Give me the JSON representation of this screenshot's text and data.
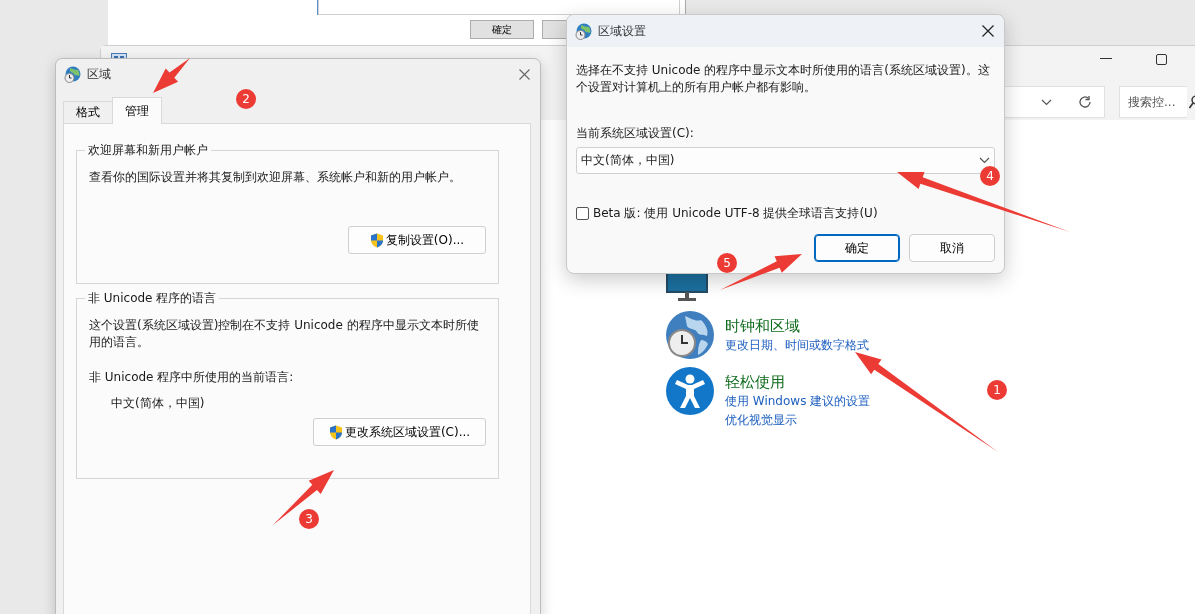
{
  "background_window": {
    "buttons": [
      "確定"
    ]
  },
  "control_panel": {
    "search": {
      "placeholder": "搜索控..."
    },
    "categories": [
      {
        "kind": "appearance"
      },
      {
        "kind": "clock",
        "title": "时钟和区域",
        "links": [
          "更改日期、时间或数字格式"
        ]
      },
      {
        "kind": "accessibility",
        "title": "轻松使用",
        "links": [
          "使用 Windows 建议的设置",
          "优化视觉显示"
        ]
      }
    ]
  },
  "region_dialog": {
    "title": "区域",
    "tabs": [
      {
        "label": "格式",
        "selected": false
      },
      {
        "label": "管理",
        "selected": true
      }
    ],
    "groups": [
      {
        "title": "欢迎屏幕和新用户帐户",
        "text": "查看你的国际设置并将其复制到欢迎屏幕、系统帐户和新的用户帐户。",
        "button": "复制设置(O)..."
      },
      {
        "title": "非 Unicode 程序的语言",
        "text": "这个设置(系统区域设置)控制在不支持 Unicode 的程序中显示文本时所使用的语言。",
        "current_label": "非 Unicode 程序中所使用的当前语言:",
        "current_value": "中文(简体，中国)",
        "button": "更改系统区域设置(C)..."
      }
    ]
  },
  "locale_dialog": {
    "title": "区域设置",
    "description": "选择在不支持 Unicode 的程序中显示文本时所使用的语言(系统区域设置)。这个设置对计算机上的所有用户帐户都有影响。",
    "locale_label": "当前系统区域设置(C):",
    "locale_value": "中文(简体，中国)",
    "beta_checkbox": {
      "label": "Beta 版: 使用 Unicode UTF-8 提供全球语言支持(U)",
      "checked": false
    },
    "buttons": [
      {
        "label": "确定",
        "default": true
      },
      {
        "label": "取消",
        "default": false
      }
    ]
  },
  "annotations": [
    {
      "label": "1"
    },
    {
      "label": "2"
    },
    {
      "label": "3"
    },
    {
      "label": "4"
    },
    {
      "label": "5"
    }
  ]
}
